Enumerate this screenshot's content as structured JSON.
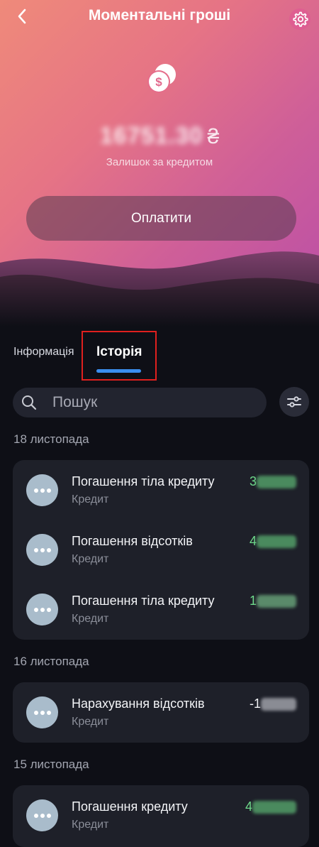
{
  "header": {
    "title": "Моментальні гроші",
    "back_icon": "chevron-left-icon",
    "settings_icon": "gear-icon"
  },
  "balance": {
    "amount": "16751.30",
    "currency": "₴",
    "label": "Залишок за кредитом"
  },
  "pay_button": {
    "label": "Оплатити"
  },
  "tabs": [
    {
      "label": "Інформація",
      "active": false
    },
    {
      "label": "Історія",
      "active": true
    }
  ],
  "search": {
    "placeholder": "Пошук",
    "value": ""
  },
  "groups": [
    {
      "date": "18 листопада",
      "items": [
        {
          "title": "Погашення тіла кредиту",
          "subtitle": "Кредит",
          "amount_visible": "3",
          "amount_color": "#6fdc8c"
        },
        {
          "title": "Погашення відсотків",
          "subtitle": "Кредит",
          "amount_visible": "4",
          "amount_color": "#6fdc8c"
        },
        {
          "title": "Погашення тіла кредиту",
          "subtitle": "Кредит",
          "amount_visible": "1",
          "amount_color": "#6fdc8c"
        }
      ]
    },
    {
      "date": "16 листопада",
      "items": [
        {
          "title": "Нарахування відсотків",
          "subtitle": "Кредит",
          "amount_visible": "-1",
          "amount_color": "#f3f4f7"
        }
      ]
    },
    {
      "date": "15 листопада",
      "items": [
        {
          "title": "Погашення кредиту",
          "subtitle": "Кредит",
          "amount_visible": "4",
          "amount_color": "#6fdc8c"
        }
      ]
    }
  ],
  "colors": {
    "accent": "#3b8ff0",
    "positive": "#6fdc8c",
    "highlight": "#e0201e"
  }
}
